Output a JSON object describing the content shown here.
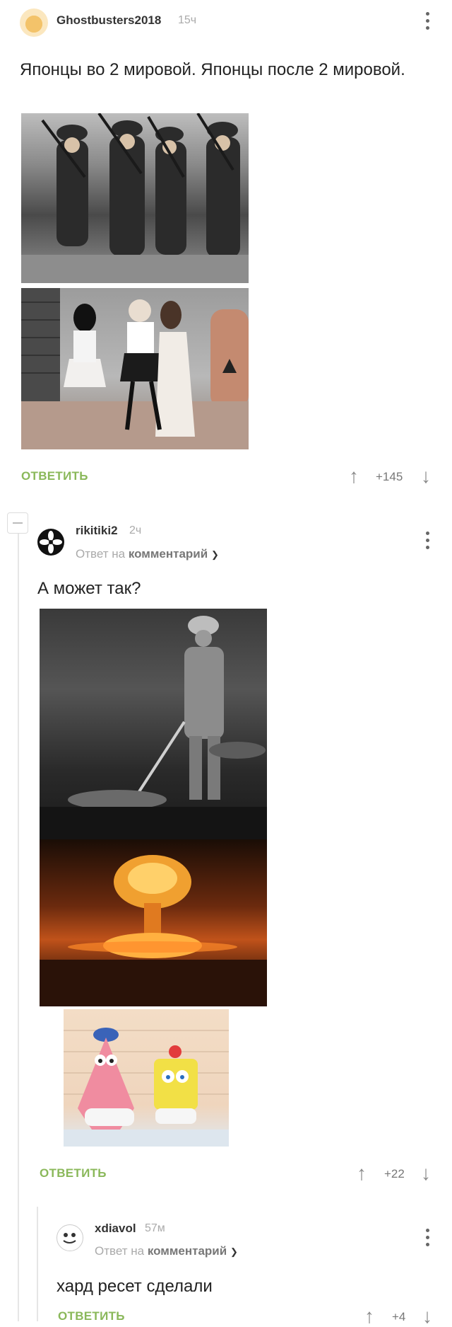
{
  "post": {
    "username": "Ghostbusters2018",
    "time": "15ч",
    "text": "Японцы во 2 мировой. Японцы после 2 мировой.",
    "reply_label": "ОТВЕТИТЬ",
    "score": "+145"
  },
  "comment1": {
    "username": "rikitiki2",
    "time": "2ч",
    "reply_to_prefix": "Ответ на",
    "reply_to_target": "комментарий",
    "text": "А может так?",
    "reply_label": "ОТВЕТИТЬ",
    "score": "+22"
  },
  "comment2": {
    "username": "xdiavol",
    "time": "57м",
    "reply_to_prefix": "Ответ на",
    "reply_to_target": "комментарий",
    "text": "хард ресет сделали",
    "reply_label": "ОТВЕТИТЬ",
    "score": "+4"
  },
  "icons": {
    "collapse": "minus-icon",
    "upvote": "arrow-up-icon",
    "downvote": "arrow-down-icon",
    "more": "kebab-icon",
    "chevron": "chevron-down-icon"
  },
  "colors": {
    "accent": "#8ab85a",
    "muted": "#aaaaaa"
  }
}
